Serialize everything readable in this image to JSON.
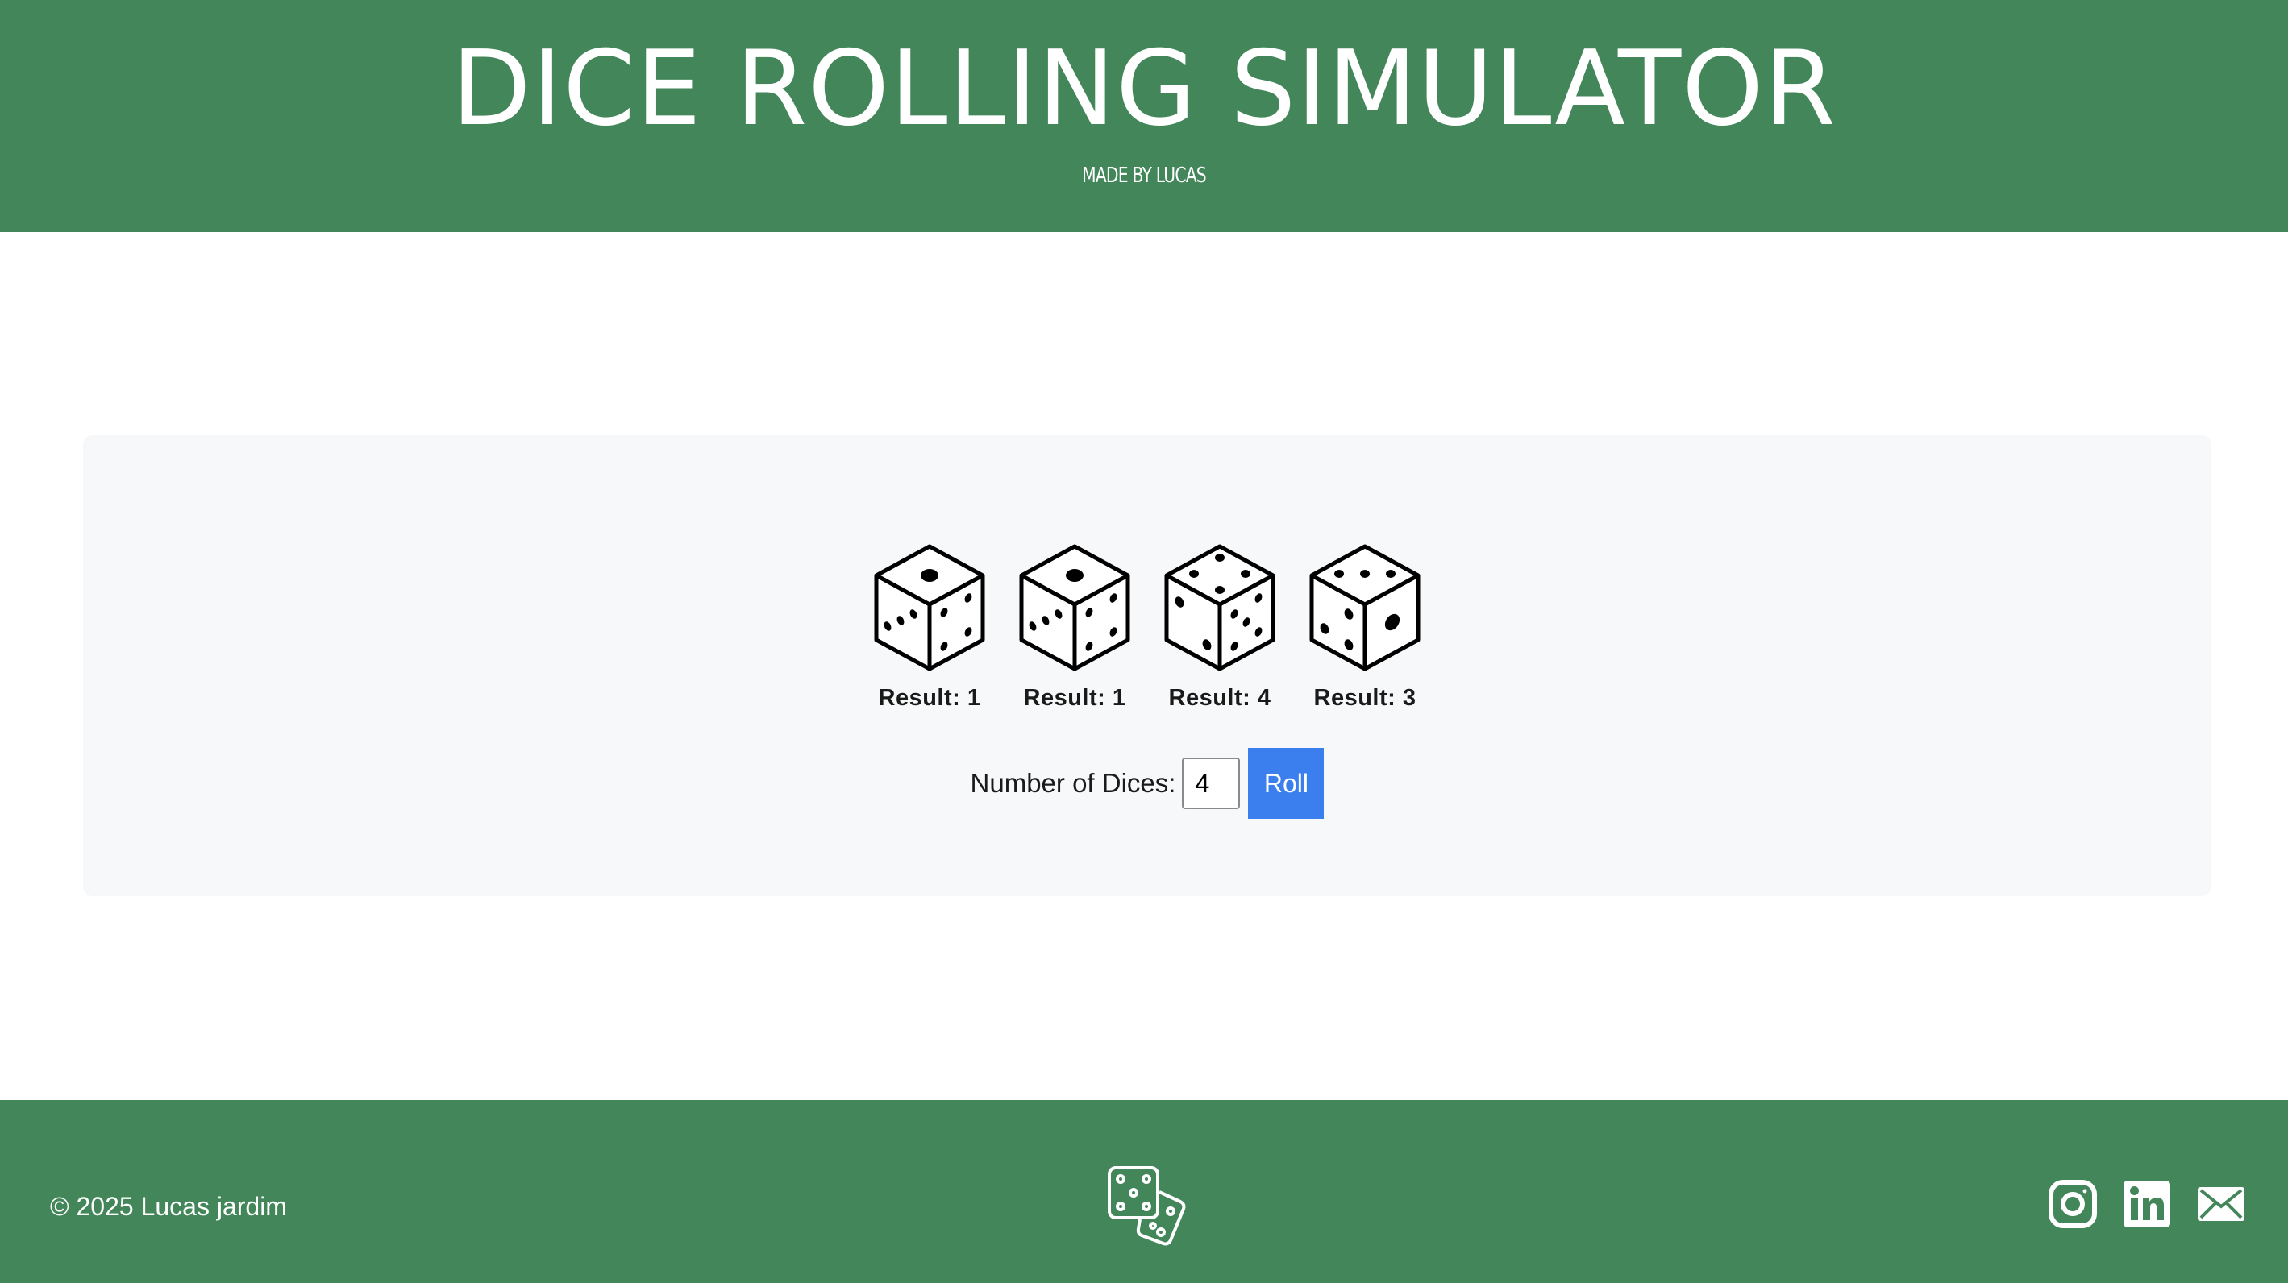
{
  "header": {
    "title": "DICE ROLLING SIMULATOR",
    "subtitle": "MADE BY LUCAS"
  },
  "dice": [
    {
      "value": 1,
      "label": "Result: 1"
    },
    {
      "value": 1,
      "label": "Result: 1"
    },
    {
      "value": 4,
      "label": "Result: 4"
    },
    {
      "value": 3,
      "label": "Result: 3"
    }
  ],
  "controls": {
    "count_label": "Number of Dices:",
    "count_value": "4",
    "roll_label": "Roll"
  },
  "footer": {
    "copyright": "© 2025 Lucas jardim",
    "logo_icon": "dice-logo-icon",
    "social": [
      {
        "name": "instagram-icon"
      },
      {
        "name": "linkedin-icon"
      },
      {
        "name": "mail-icon"
      }
    ]
  },
  "colors": {
    "brand_green": "#42865a",
    "panel_bg": "#f7f8f9",
    "button_blue": "#3b7fef"
  }
}
